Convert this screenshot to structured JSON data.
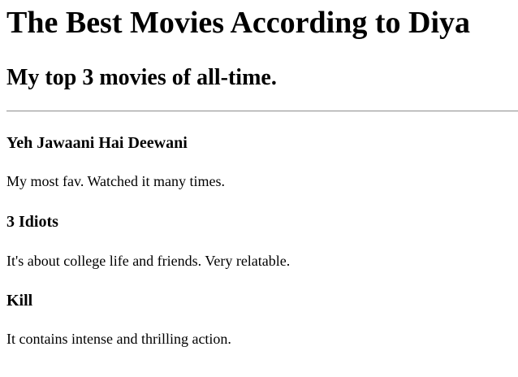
{
  "page": {
    "title": "The Best Movies According to Diya",
    "subtitle": "My top 3 movies of all-time."
  },
  "movies": [
    {
      "title": "Yeh Jawaani Hai Deewani",
      "description": "My most fav. Watched it many times."
    },
    {
      "title": "3 Idiots",
      "description": "It's about college life and friends. Very relatable."
    },
    {
      "title": "Kill",
      "description": "It contains intense and thrilling action."
    }
  ]
}
